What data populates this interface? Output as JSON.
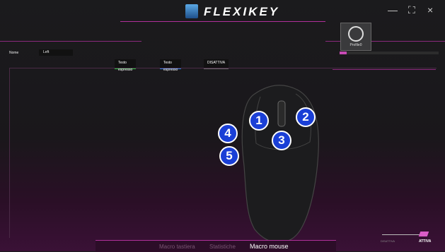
{
  "app": {
    "brand": "FLEXIKEY"
  },
  "window_controls": {
    "minimize": "—",
    "maximize": "⛶",
    "close": "×"
  },
  "profile": {
    "name": "Profile0",
    "icon": "skull-crest-icon"
  },
  "mapping": {
    "name_label": "Nome",
    "name_value": "Left"
  },
  "tabs": [
    {
      "label": "Testo espresso",
      "color": "#27c03a"
    },
    {
      "label": "Testo espresso",
      "color": "#2f7fe0"
    },
    {
      "label": "DISATTIVA",
      "color": "#6a6a6a"
    }
  ],
  "buttons": [
    "1",
    "2",
    "3",
    "4",
    "5"
  ],
  "bottom_nav": [
    {
      "label": "Macro tastiera",
      "active": false
    },
    {
      "label": "Statistiche",
      "active": false
    },
    {
      "label": "Macro mouse",
      "active": true
    }
  ],
  "toggle": {
    "off_label": "DISATTIVA",
    "on_label": "ATTIVA"
  },
  "colors": {
    "accent": "#b0309a",
    "badge": "#1a3fd6"
  }
}
